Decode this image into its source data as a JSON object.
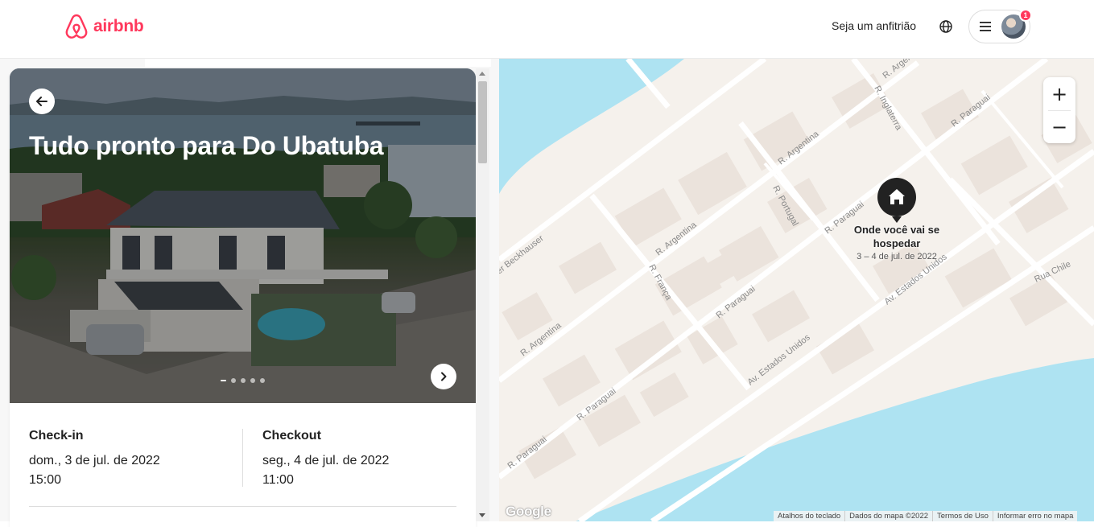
{
  "header": {
    "logo_text": "airbnb",
    "host_link": "Seja um anfitrião",
    "notification_count": "1"
  },
  "trip": {
    "title": "Tudo pronto para Do Ubatuba",
    "checkin_label": "Check-in",
    "checkin_date": "dom., 3 de jul. de 2022",
    "checkin_time": "15:00",
    "checkout_label": "Checkout",
    "checkout_date": "seg., 4 de jul. de 2022",
    "checkout_time": "11:00"
  },
  "map": {
    "pin_title": "Onde você vai se hospedar",
    "pin_dates": "3 – 4 de jul. de 2022",
    "zoom_in": "+",
    "zoom_out": "−",
    "google_logo": "Google",
    "footer": [
      "Atalhos do teclado",
      "Dados do mapa ©2022",
      "Termos de Uso",
      "Informar erro no mapa"
    ],
    "streets": [
      "R. Argentina",
      "R. Argentina",
      "R. Argentina",
      "R. Argentina",
      "R. Paraguai",
      "R. Paraguai",
      "R. Paraguai",
      "R. Paraguai",
      "R. Paraguai",
      "R. Portugal",
      "R. França",
      "R. Inglaterra",
      "Av. Estados Unidos",
      "Av. Estados Unidos",
      "Rua Chile",
      "er Beckhauser",
      "R. Argen",
      "R. Paraguai"
    ]
  },
  "colors": {
    "brand": "#ff385c",
    "water": "#aee3f2",
    "land": "#f5f1ec"
  }
}
